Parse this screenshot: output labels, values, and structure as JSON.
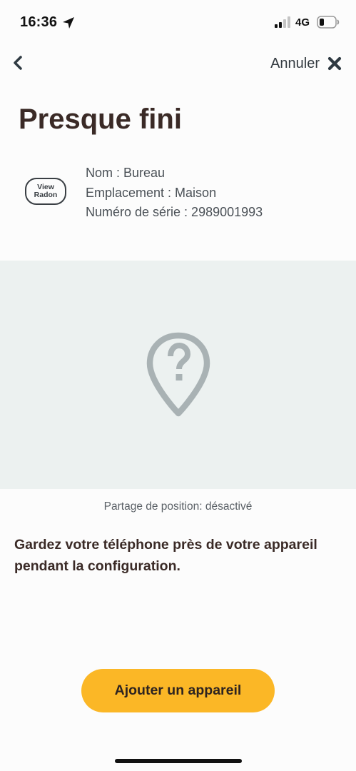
{
  "status_bar": {
    "time": "16:36",
    "network": "4G"
  },
  "nav": {
    "cancel_label": "Annuler"
  },
  "page": {
    "title": "Presque fini"
  },
  "device": {
    "logo_line1": "View",
    "logo_line2": "Radon",
    "name": "Nom : Bureau",
    "location": "Emplacement : Maison",
    "serial": "Numéro de série : 2989001993"
  },
  "map": {
    "icon": "location-unknown-pin-icon",
    "status": "Partage de position: désactivé"
  },
  "instruction": "Gardez votre téléphone près de votre appareil pendant la configuration.",
  "actions": {
    "add_device_label": "Ajouter un appareil"
  },
  "colors": {
    "accent": "#fbb726",
    "map_background": "#ecf1f0",
    "title": "#3a2a26"
  }
}
